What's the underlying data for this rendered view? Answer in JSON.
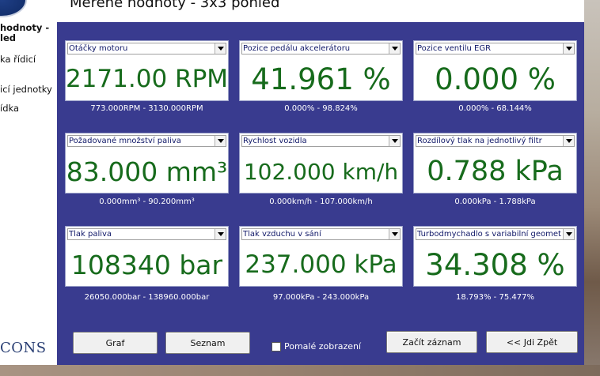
{
  "window": {
    "title": "Měřené hodnoty - 3x3 pohled"
  },
  "sidebar": {
    "active_item": "hodnoty -\nled",
    "items": [
      {
        "label": "ka řídicí"
      },
      {
        "label": "icí jednotky"
      },
      {
        "label": "ídka"
      }
    ],
    "brand": "CONS"
  },
  "tiles": [
    {
      "label": "Otáčky motoru",
      "value": "2171.00 RPM",
      "range": "773.000RPM - 3130.000RPM"
    },
    {
      "label": "Pozice pedálu akcelerátoru",
      "value": "41.961 %",
      "range": "0.000% - 98.824%"
    },
    {
      "label": "Pozice ventilu EGR",
      "value": "0.000 %",
      "range": "0.000% - 68.144%"
    },
    {
      "label": "Požadované množství paliva",
      "value": "83.000 mm³",
      "range": "0.000mm³ - 90.200mm³"
    },
    {
      "label": "Rychlost vozidla",
      "value": "102.000 km/h",
      "range": "0.000km/h - 107.000km/h"
    },
    {
      "label": "Rozdílový tlak na jednotlivý filtr",
      "value": "0.788 kPa",
      "range": "0.000kPa - 1.788kPa"
    },
    {
      "label": "Tlak paliva",
      "value": "108340 bar",
      "range": "26050.000bar - 138960.000bar"
    },
    {
      "label": "Tlak vzduchu v sání",
      "value": "237.000 kPa",
      "range": "97.000kPa - 243.000kPa"
    },
    {
      "label": "Turbodmychadlo s variabilní geometrií",
      "value": "34.308 %",
      "range": "18.793% - 75.477%"
    }
  ],
  "buttons": {
    "graph": "Graf",
    "list": "Seznam",
    "slow_display": "Pomalé zobrazení",
    "start_record": "Začít záznam",
    "back": "<< Jdi Zpět"
  },
  "colors": {
    "panel_bg": "#393b8f",
    "value_text": "#176b1c",
    "label_text": "#101868"
  }
}
